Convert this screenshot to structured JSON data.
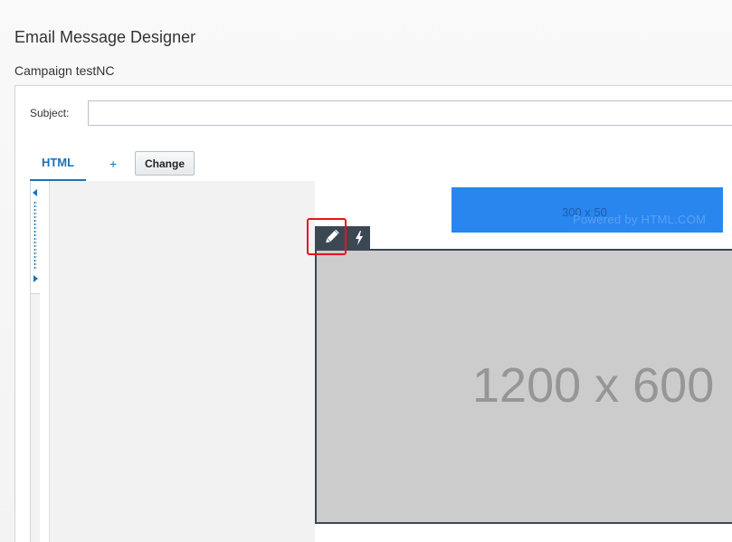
{
  "page": {
    "title": "Email Message Designer",
    "campaign": "Campaign testNC"
  },
  "form": {
    "subject_label": "Subject:",
    "subject_value": "",
    "subject_placeholder": ""
  },
  "tabs": {
    "items": [
      {
        "label": "HTML",
        "active": true
      }
    ],
    "add_label": "+",
    "change_label": "Change"
  },
  "editor": {
    "banner": {
      "size_text": "300 x 50",
      "powered_text": "Powered by HTML.COM",
      "color": "#2a86ef"
    },
    "image_placeholder": {
      "text": "1200 x 600",
      "color": "#cccccc"
    },
    "toolbar": {
      "edit_icon": "pencil-icon",
      "dynamic_icon": "lightning-icon",
      "background": "#3c4754"
    },
    "highlight_color": "#e8141a"
  },
  "colors": {
    "accent": "#1a73b8"
  }
}
